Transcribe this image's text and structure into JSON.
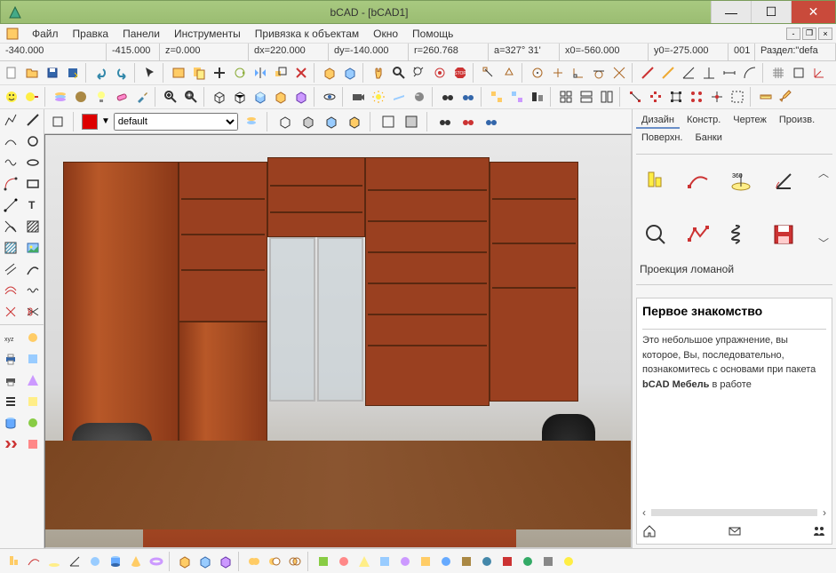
{
  "window": {
    "title": "bCAD - [bCAD1]",
    "minimize": "—",
    "maximize": "☐",
    "close": "✕"
  },
  "menu": {
    "file": "Файл",
    "edit": "Правка",
    "panels": "Панели",
    "tools": "Инструменты",
    "snap": "Привязка к объектам",
    "window": "Окно",
    "help": "Помощь"
  },
  "coords": {
    "x": "-340.000",
    "y": "-415.000",
    "z": "z=0.000",
    "dx": "dx=220.000",
    "dy": "dy=-140.000",
    "r": "r=260.768",
    "a": "a=327° 31'",
    "x0": "x0=-560.000",
    "y0": "y0=-275.000",
    "num": "001",
    "section": "Раздел:\"defa"
  },
  "center_toolbar": {
    "layer_dropdown": "default"
  },
  "right": {
    "tabs": {
      "design": "Дизайн",
      "konstr": "Констр.",
      "drawing": "Чертеж",
      "prod": "Произв.",
      "surface": "Поверхн.",
      "banks": "Банки"
    },
    "proj_label": "Проекция ломаной",
    "panel2_title": "Первое знакомство",
    "panel2_body_1": "Это небольшое упражнение, вы которое, Вы, последовательно, познакомитесь с основами при пакета ",
    "panel2_body_bold": "bCAD Мебель",
    "panel2_body_2": " в работе"
  }
}
